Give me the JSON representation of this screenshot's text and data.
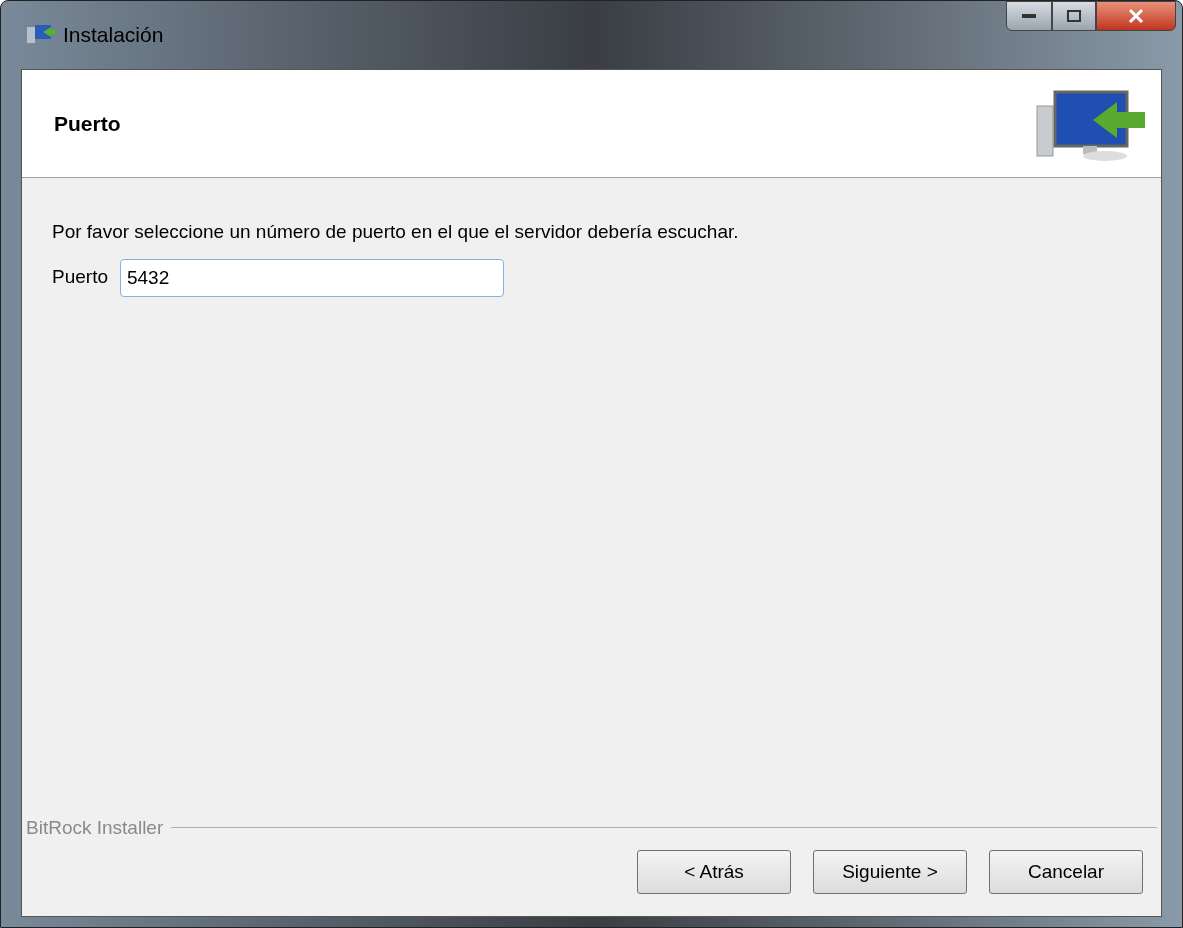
{
  "window": {
    "title": "Instalación"
  },
  "header": {
    "title": "Puerto"
  },
  "body": {
    "instruction": "Por favor seleccione un número de puerto en el que el servidor debería escuchar.",
    "port_field": {
      "label": "Puerto",
      "value": "5432"
    }
  },
  "footer": {
    "brand": "BitRock Installer",
    "buttons": [
      "< Atrás",
      "Siguiente >",
      "Cancelar"
    ]
  }
}
